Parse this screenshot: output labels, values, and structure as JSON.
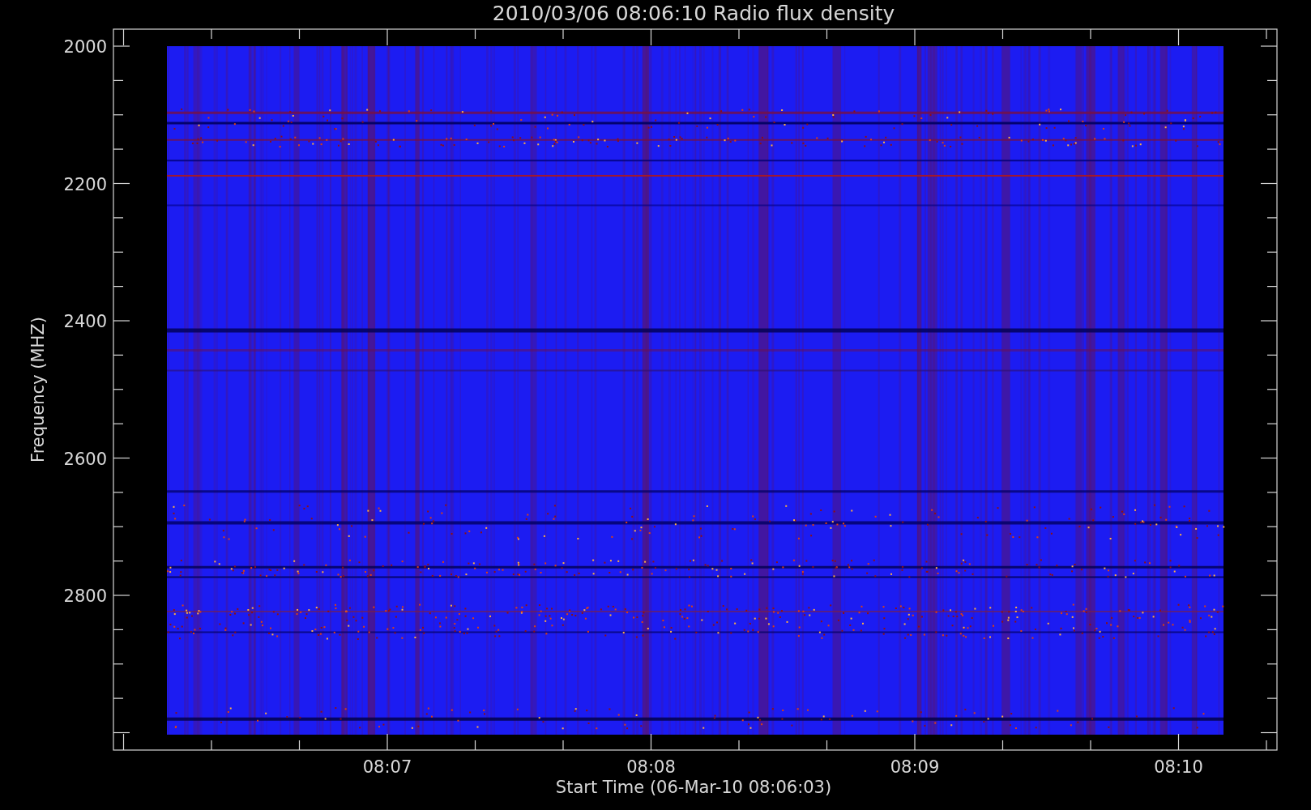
{
  "plot": {
    "title": "2010/03/06 08:06:10 Radio flux density",
    "y_axis": {
      "label": "Frequency (MHZ)",
      "tick_labels": [
        "2000",
        "2200",
        "2400",
        "2600",
        "2800"
      ]
    },
    "x_axis": {
      "label": "Start Time (06-Mar-10 08:06:03)",
      "tick_labels": [
        "08:07",
        "08:08",
        "08:09",
        "08:10"
      ]
    }
  }
}
